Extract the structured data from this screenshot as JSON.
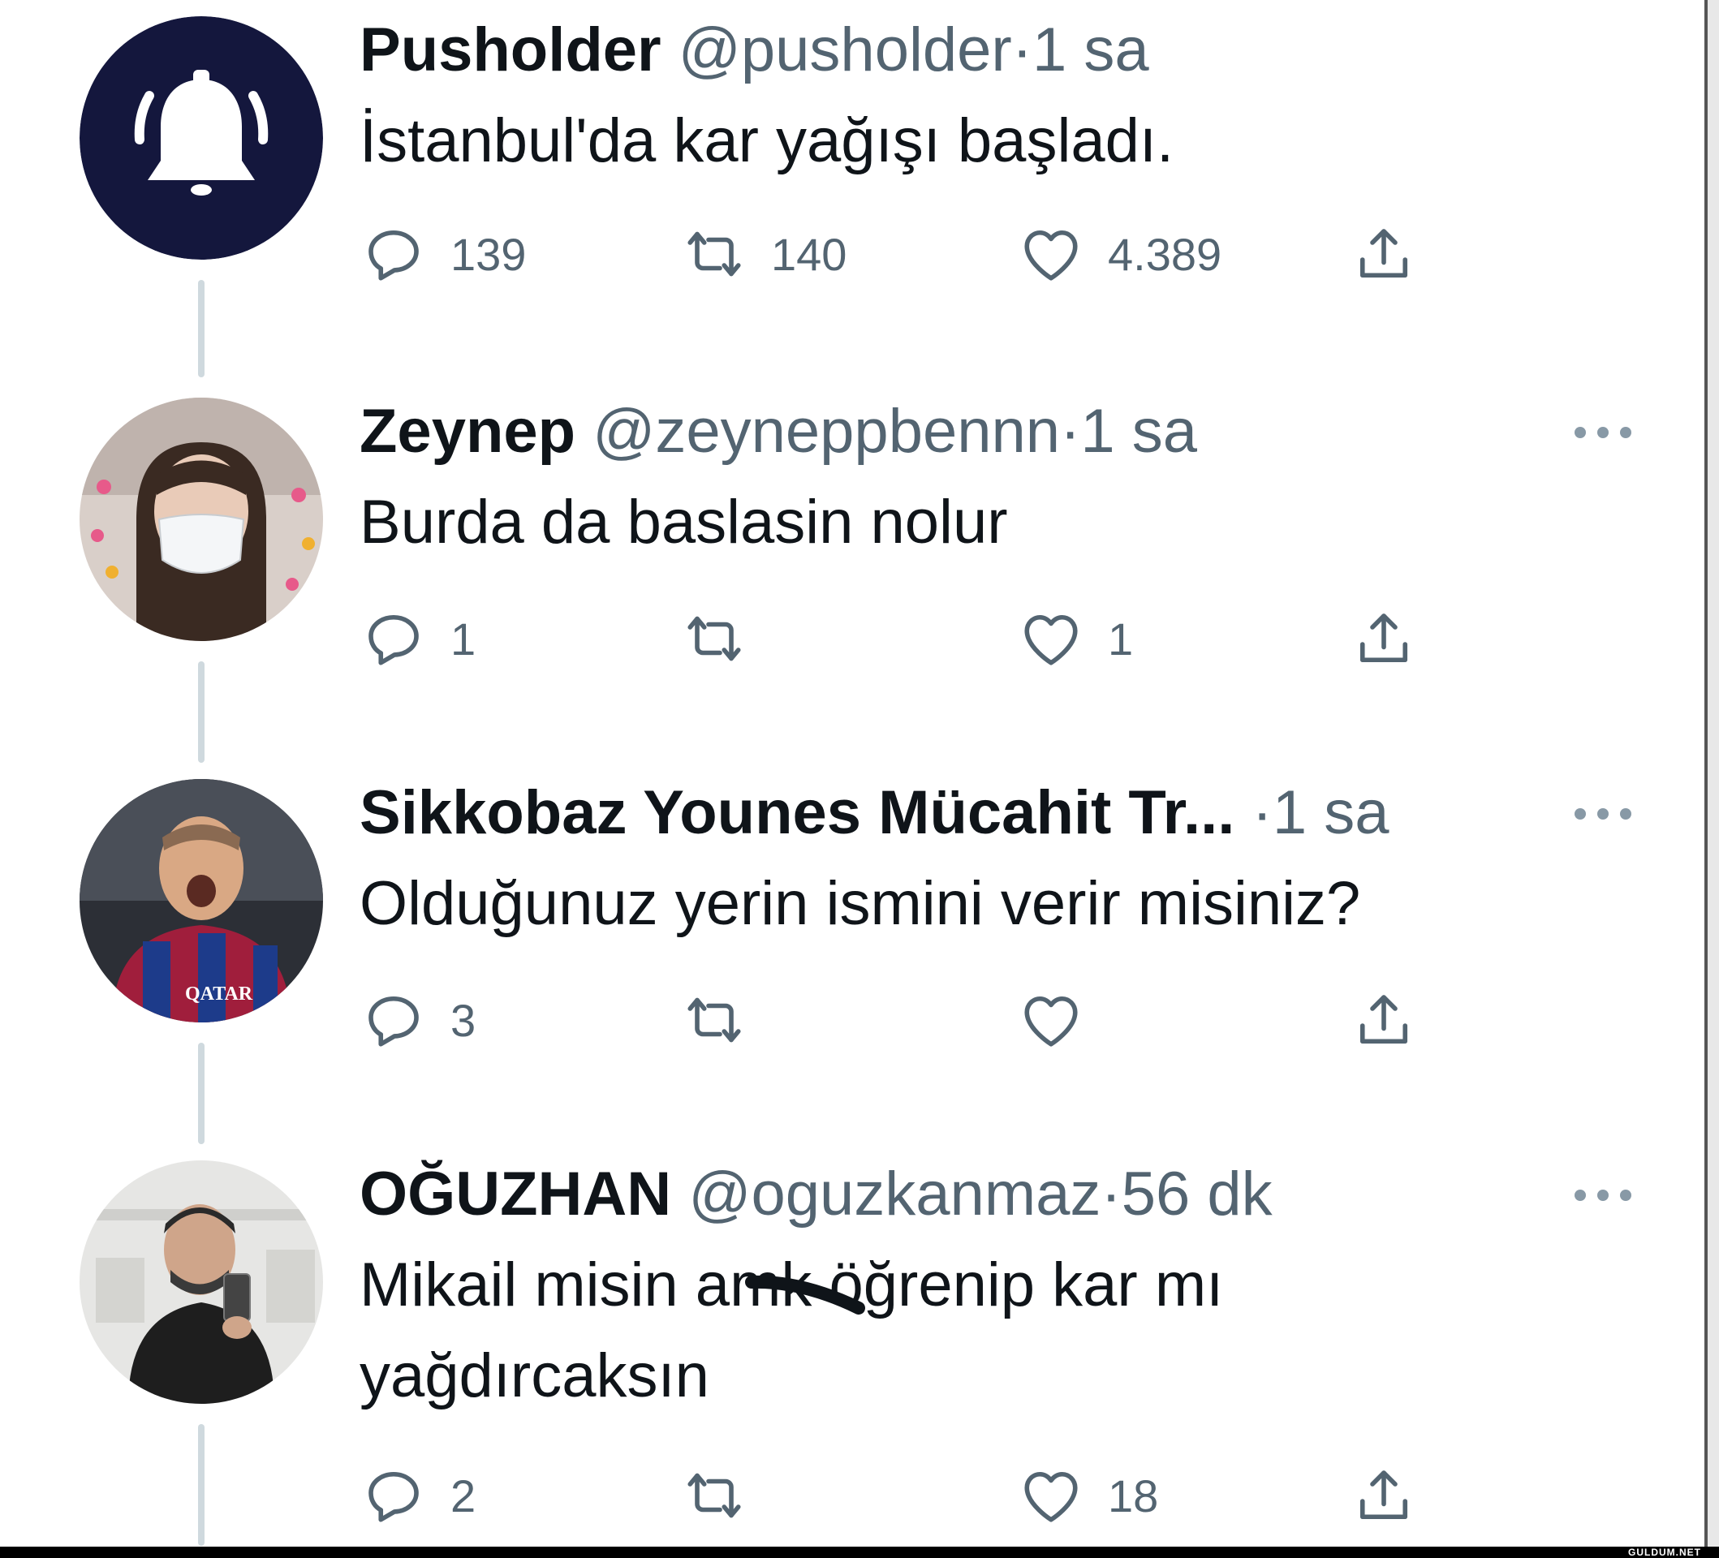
{
  "tweets": [
    {
      "name": "Pusholder",
      "handle": "@pusholder",
      "dot": "·",
      "time": "1 sa",
      "text": "İstanbul'da kar yağışı başladı.",
      "avatar_icon": "bell-icon",
      "has_more": false,
      "counts": {
        "reply": "139",
        "retweet": "140",
        "like": "4.389"
      }
    },
    {
      "name": "Zeynep",
      "handle": "@zeyneppbennn",
      "dot": "·",
      "time": "1 sa",
      "text": "Burda da baslasin nolur",
      "avatar_icon": "user-photo",
      "has_more": true,
      "counts": {
        "reply": "1",
        "retweet": "",
        "like": "1"
      }
    },
    {
      "name": "Sikkobaz Younes Mücahit Tr...",
      "handle": "",
      "dot": "·",
      "time": "1 sa",
      "text": "Olduğunuz yerin ismini verir misiniz?",
      "avatar_icon": "user-photo",
      "has_more": true,
      "counts": {
        "reply": "3",
        "retweet": "",
        "like": ""
      }
    },
    {
      "name": "OĞUZHAN",
      "handle": "@oguzkanmaz",
      "dot": "·",
      "time": "56 dk",
      "text": "Mikail misin amk öğrenip kar mı yağdırcaksın",
      "avatar_icon": "user-photo",
      "has_more": true,
      "counts": {
        "reply": "2",
        "retweet": "",
        "like": "18"
      }
    }
  ],
  "watermark": "GULDUM.NET",
  "colors": {
    "accent_dark_navy": "#14173d",
    "secondary_text": "#536471",
    "icon_gray": "#536471",
    "thread_line": "#cfd9de"
  }
}
